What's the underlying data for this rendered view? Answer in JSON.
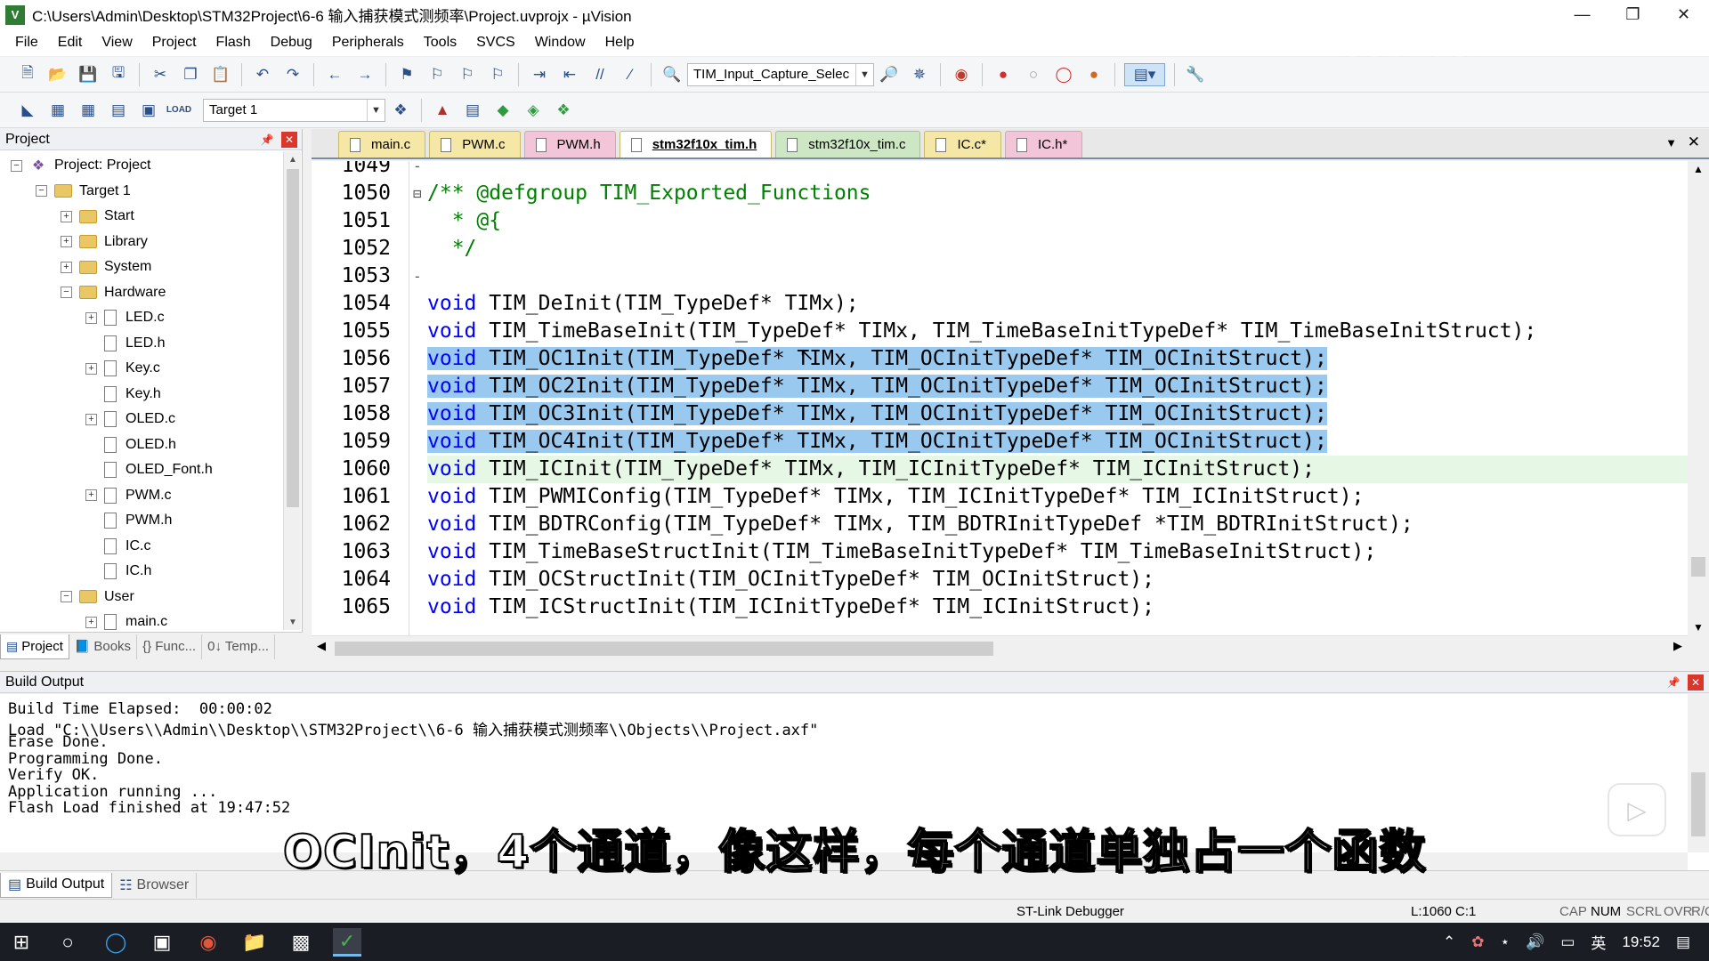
{
  "window": {
    "title": "C:\\Users\\Admin\\Desktop\\STM32Project\\6-6 输入捕获模式测频率\\Project.uvprojx - µVision",
    "app_icon": "V"
  },
  "menu": [
    "File",
    "Edit",
    "View",
    "Project",
    "Flash",
    "Debug",
    "Peripherals",
    "Tools",
    "SVCS",
    "Window",
    "Help"
  ],
  "toolbar": {
    "find_combo_value": "TIM_Input_Capture_Selec",
    "target_combo_value": "Target 1"
  },
  "project_panel": {
    "title": "Project",
    "tree": [
      {
        "label": "Project: Project",
        "kind": "project",
        "expander": "−",
        "level": 0
      },
      {
        "label": "Target 1",
        "kind": "folder",
        "expander": "−",
        "level": 1
      },
      {
        "label": "Start",
        "kind": "folder",
        "expander": "+",
        "level": 2
      },
      {
        "label": "Library",
        "kind": "folder",
        "expander": "+",
        "level": 2
      },
      {
        "label": "System",
        "kind": "folder",
        "expander": "+",
        "level": 2
      },
      {
        "label": "Hardware",
        "kind": "folder",
        "expander": "−",
        "level": 2
      },
      {
        "label": "LED.c",
        "kind": "file",
        "expander": "+",
        "level": 3
      },
      {
        "label": "LED.h",
        "kind": "file",
        "expander": "",
        "level": 3
      },
      {
        "label": "Key.c",
        "kind": "file",
        "expander": "+",
        "level": 3
      },
      {
        "label": "Key.h",
        "kind": "file",
        "expander": "",
        "level": 3
      },
      {
        "label": "OLED.c",
        "kind": "file",
        "expander": "+",
        "level": 3
      },
      {
        "label": "OLED.h",
        "kind": "file",
        "expander": "",
        "level": 3
      },
      {
        "label": "OLED_Font.h",
        "kind": "file",
        "expander": "",
        "level": 3
      },
      {
        "label": "PWM.c",
        "kind": "file",
        "expander": "+",
        "level": 3
      },
      {
        "label": "PWM.h",
        "kind": "file",
        "expander": "",
        "level": 3
      },
      {
        "label": "IC.c",
        "kind": "file",
        "expander": "",
        "level": 3
      },
      {
        "label": "IC.h",
        "kind": "file",
        "expander": "",
        "level": 3
      },
      {
        "label": "User",
        "kind": "folder",
        "expander": "−",
        "level": 2
      },
      {
        "label": "main.c",
        "kind": "file",
        "expander": "+",
        "level": 3
      }
    ],
    "tabs": [
      "Project",
      "Books",
      "{} Func...",
      "0↓ Temp..."
    ]
  },
  "editor": {
    "tabs": [
      {
        "label": "main.c",
        "color": "c1"
      },
      {
        "label": "PWM.c",
        "color": "c1"
      },
      {
        "label": "PWM.h",
        "color": "c2"
      },
      {
        "label": "stm32f10x_tim.h",
        "color": "active"
      },
      {
        "label": "stm32f10x_tim.c",
        "color": "c3"
      },
      {
        "label": "IC.c*",
        "color": "c1"
      },
      {
        "label": "IC.h*",
        "color": "c2"
      }
    ],
    "lines": [
      {
        "num": "1049",
        "text": "",
        "state": "",
        "fold": "-"
      },
      {
        "num": "1050",
        "text": "/** @defgroup TIM_Exported_Functions",
        "state": "comment",
        "fold": "⊟"
      },
      {
        "num": "1051",
        "text": "  * @{",
        "state": "comment",
        "fold": ""
      },
      {
        "num": "1052",
        "text": "  */",
        "state": "comment",
        "fold": ""
      },
      {
        "num": "1053",
        "text": "",
        "state": "",
        "fold": "-"
      },
      {
        "num": "1054",
        "kw": "void",
        "text": " TIM_DeInit(TIM_TypeDef* TIMx);",
        "state": "",
        "fold": ""
      },
      {
        "num": "1055",
        "kw": "void",
        "text": " TIM_TimeBaseInit(TIM_TypeDef* TIMx, TIM_TimeBaseInitTypeDef* TIM_TimeBaseInitStruct);",
        "state": "",
        "fold": ""
      },
      {
        "num": "1056",
        "kw": "void",
        "text": " TIM_OC1Init(TIM_TypeDef* TIMx, TIM_OCInitTypeDef* TIM_OCInitStruct);",
        "state": "sel",
        "fold": ""
      },
      {
        "num": "1057",
        "kw": "void",
        "text": " TIM_OC2Init(TIM_TypeDef* TIMx, TIM_OCInitTypeDef* TIM_OCInitStruct);",
        "state": "sel",
        "fold": ""
      },
      {
        "num": "1058",
        "kw": "void",
        "text": " TIM_OC3Init(TIM_TypeDef* TIMx, TIM_OCInitTypeDef* TIM_OCInitStruct);",
        "state": "sel",
        "fold": ""
      },
      {
        "num": "1059",
        "kw": "void",
        "text": " TIM_OC4Init(TIM_TypeDef* TIMx, TIM_OCInitTypeDef* TIM_OCInitStruct);",
        "state": "sel",
        "fold": ""
      },
      {
        "num": "1060",
        "kw": "void",
        "text": " TIM_ICInit(TIM_TypeDef* TIMx, TIM_ICInitTypeDef* TIM_ICInitStruct);",
        "state": "current",
        "fold": ""
      },
      {
        "num": "1061",
        "kw": "void",
        "text": " TIM_PWMIConfig(TIM_TypeDef* TIMx, TIM_ICInitTypeDef* TIM_ICInitStruct);",
        "state": "",
        "fold": ""
      },
      {
        "num": "1062",
        "kw": "void",
        "text": " TIM_BDTRConfig(TIM_TypeDef* TIMx, TIM_BDTRInitTypeDef *TIM_BDTRInitStruct);",
        "state": "",
        "fold": ""
      },
      {
        "num": "1063",
        "kw": "void",
        "text": " TIM_TimeBaseStructInit(TIM_TimeBaseInitTypeDef* TIM_TimeBaseInitStruct);",
        "state": "",
        "fold": ""
      },
      {
        "num": "1064",
        "kw": "void",
        "text": " TIM_OCStructInit(TIM_OCInitTypeDef* TIM_OCInitStruct);",
        "state": "",
        "fold": ""
      },
      {
        "num": "1065",
        "kw": "void",
        "text": " TIM_ICStructInit(TIM_ICInitTypeDef* TIM_ICInitStruct);",
        "state": "",
        "fold": ""
      }
    ],
    "colors": {
      "keyword": "#0000ff",
      "comment": "#008000",
      "selection": "#99c9ef",
      "current_line": "#e6f7e6"
    }
  },
  "build_output": {
    "title": "Build Output",
    "lines": [
      "Build Time Elapsed:  00:00:02",
      "Load \"C:\\\\Users\\\\Admin\\\\Desktop\\\\STM32Project\\\\6-6 输入捕获模式测频率\\\\Objects\\\\Project.axf\"",
      "Erase Done.",
      "Programming Done.",
      "Verify OK.",
      "Application running ...",
      "Flash Load finished at 19:47:52"
    ],
    "tabs": [
      "Build Output",
      "Browser"
    ]
  },
  "subtitle": "OCInit，4个通道，像这样，每个通道单独占一个函数",
  "status": {
    "debugger": "ST-Link Debugger",
    "position": "L:1060 C:1",
    "indicators": [
      "CAP",
      "NUM",
      "SCRL",
      "OVR",
      "R/O"
    ]
  },
  "taskbar": {
    "tray_lang": "英",
    "time": "19:52"
  }
}
